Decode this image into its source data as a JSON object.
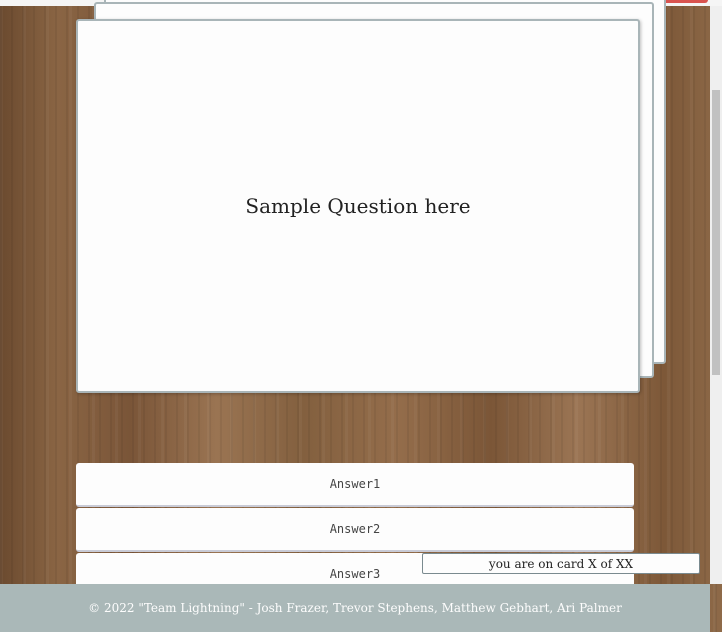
{
  "card": {
    "question": "Sample Question here"
  },
  "answers": [
    {
      "label": "Answer1"
    },
    {
      "label": "Answer2"
    },
    {
      "label": "Answer3"
    }
  ],
  "counter": {
    "text": "you are on card X of XX"
  },
  "footer": {
    "text": "© 2022 \"Team Lightning\" - Josh Frazer, Trevor Stephens, Matthew Gebhart, Ari Palmer"
  },
  "colors": {
    "card_background": "#fdfdfd",
    "card_border": "#a9b5b8",
    "footer_background": "#aab8b8",
    "footer_text": "#fdfdfd"
  }
}
